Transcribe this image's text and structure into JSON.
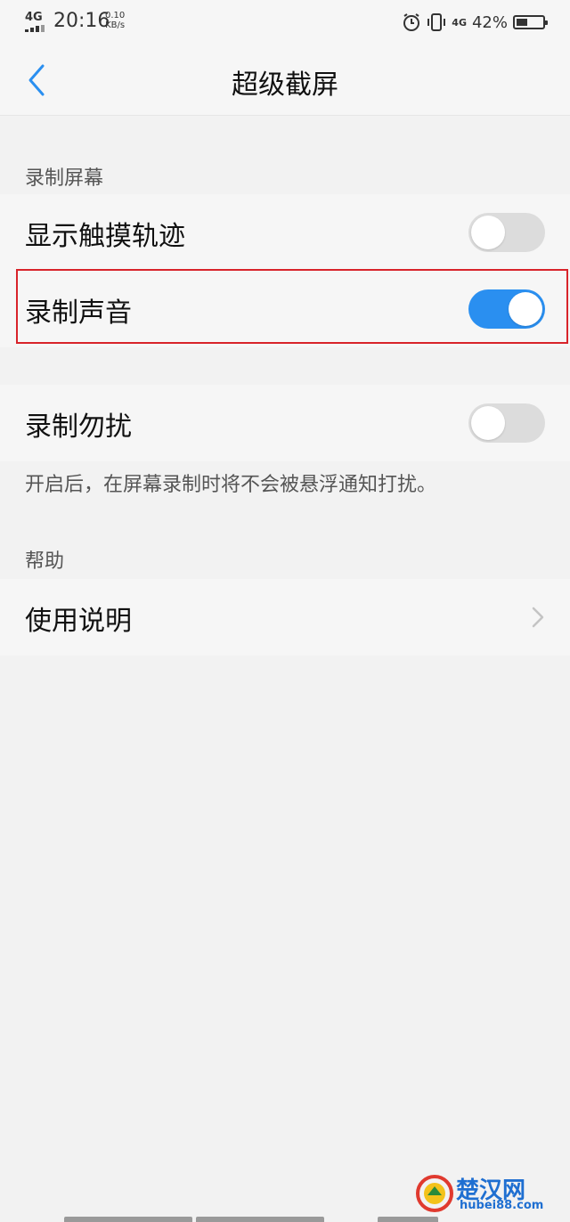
{
  "status_bar": {
    "network_left": "4G",
    "time": "20:16",
    "speed_value": "0.10",
    "speed_unit": "KB/s",
    "network_right": "4G",
    "battery_percent": "42%",
    "battery_level": 0.42,
    "icons": [
      "signal-icon",
      "alarm-icon",
      "vibrate-icon",
      "battery-icon"
    ]
  },
  "header": {
    "title": "超级截屏",
    "back_icon": "chevron-left-icon",
    "accent_color": "#2a8ff0"
  },
  "sections": {
    "record_screen": {
      "label": "录制屏幕",
      "items": [
        {
          "label": "显示触摸轨迹",
          "toggle_on": false
        },
        {
          "label": "录制声音",
          "toggle_on": true
        }
      ]
    },
    "dnd": {
      "label": "录制勿扰",
      "toggle_on": false,
      "hint": "开启后，在屏幕录制时将不会被悬浮通知打扰。"
    },
    "help": {
      "label": "帮助",
      "items": [
        {
          "label": "使用说明",
          "icon": "chevron-right-icon"
        }
      ]
    }
  },
  "highlight_color": "#d8232a",
  "watermark": {
    "text": "楚汉网",
    "url": "hubei88.com"
  }
}
